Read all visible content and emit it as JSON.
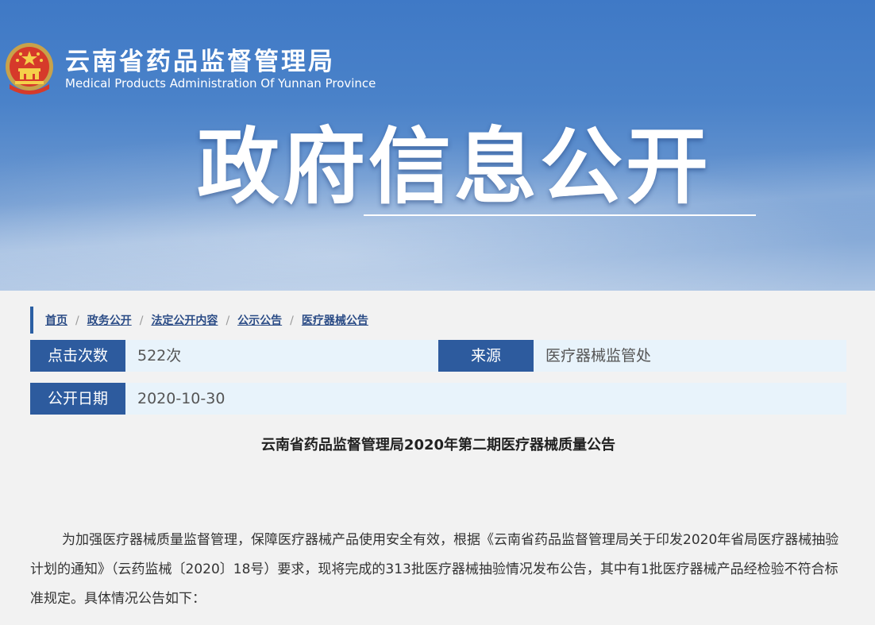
{
  "header": {
    "agency_cn": "云南省药品监督管理局",
    "agency_en": "Medical Products Administration Of Yunnan Province",
    "section_title": "政府信息公开"
  },
  "breadcrumb": {
    "items": [
      "首页",
      "政务公开",
      "法定公开内容",
      "公示公告",
      "医疗器械公告"
    ],
    "separator": "/"
  },
  "meta": {
    "clicks_label": "点击次数",
    "clicks_value": "522次",
    "source_label": "来源",
    "source_value": "医疗器械监管处",
    "date_label": "公开日期",
    "date_value": "2020-10-30"
  },
  "article": {
    "title": "云南省药品监督管理局2020年第二期医疗器械质量公告",
    "paragraph": "为加强医疗器械质量监督管理，保障医疗器械产品使用安全有效，根据《云南省药品监督管理局关于印发2020年省局医疗器械抽验计划的通知》（云药监械〔2020〕18号）要求，现将完成的313批医疗器械抽验情况发布公告，其中有1批医疗器械产品经检验不符合标准规定。具体情况公告如下："
  },
  "colors": {
    "banner_top": "#3f79c6",
    "label_bg": "#2d5b9e",
    "row_bg": "#e8f3fb",
    "page_bg": "#f2f2f2"
  }
}
